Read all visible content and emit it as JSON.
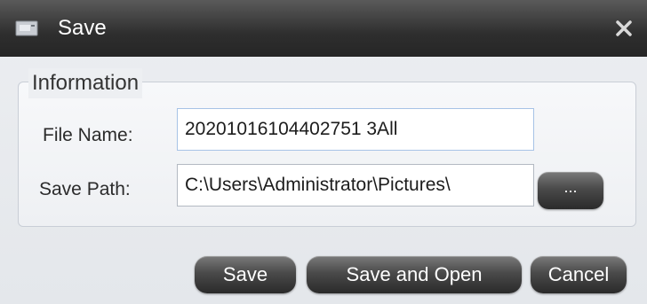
{
  "window": {
    "title": "Save",
    "icon": "save-icon",
    "close_icon": "close-icon"
  },
  "information": {
    "legend": "Information",
    "file_name_label": "File Name:",
    "file_name_value": "20201016104402751 3All",
    "save_path_label": "Save Path:",
    "save_path_value": "C:\\Users\\Administrator\\Pictures\\",
    "browse_label": "..."
  },
  "actions": {
    "save_label": "Save",
    "save_and_open_label": "Save and Open",
    "cancel_label": "Cancel"
  },
  "colors": {
    "titlebar": "#2e2e2e",
    "button": "#3a3a3a",
    "input_border_focus": "#a7c3e6"
  }
}
